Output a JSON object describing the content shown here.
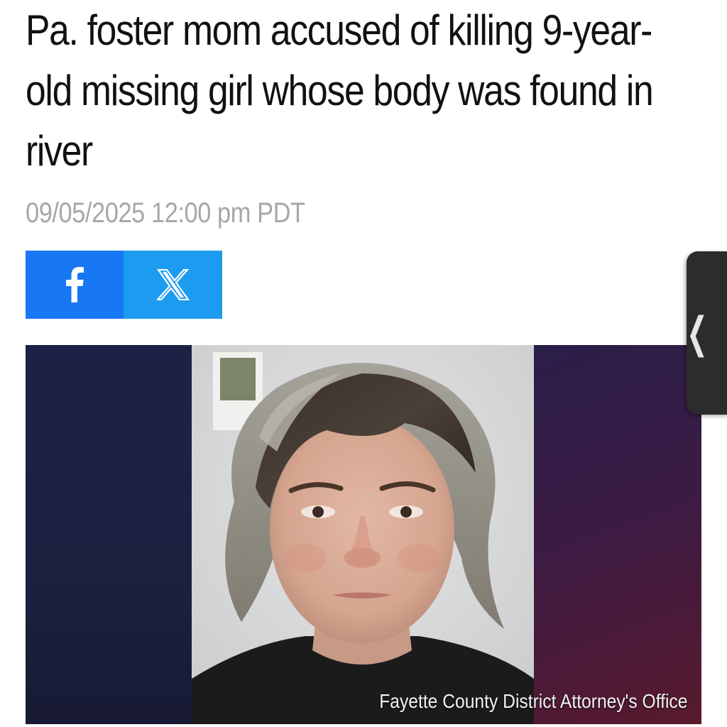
{
  "article": {
    "headline": "Pa. foster mom accused of killing 9-year-old missing girl whose body was found in river",
    "timestamp": "09/05/2025 12:00 pm PDT"
  },
  "share": {
    "facebook_icon": "facebook-icon",
    "x_icon": "x-icon",
    "facebook_color": "#1877f2",
    "x_color": "#1d9bf0"
  },
  "image": {
    "credit": "Fayette County District Attorney's Office"
  },
  "side_panel": {
    "icon": "chevron-left-icon"
  }
}
